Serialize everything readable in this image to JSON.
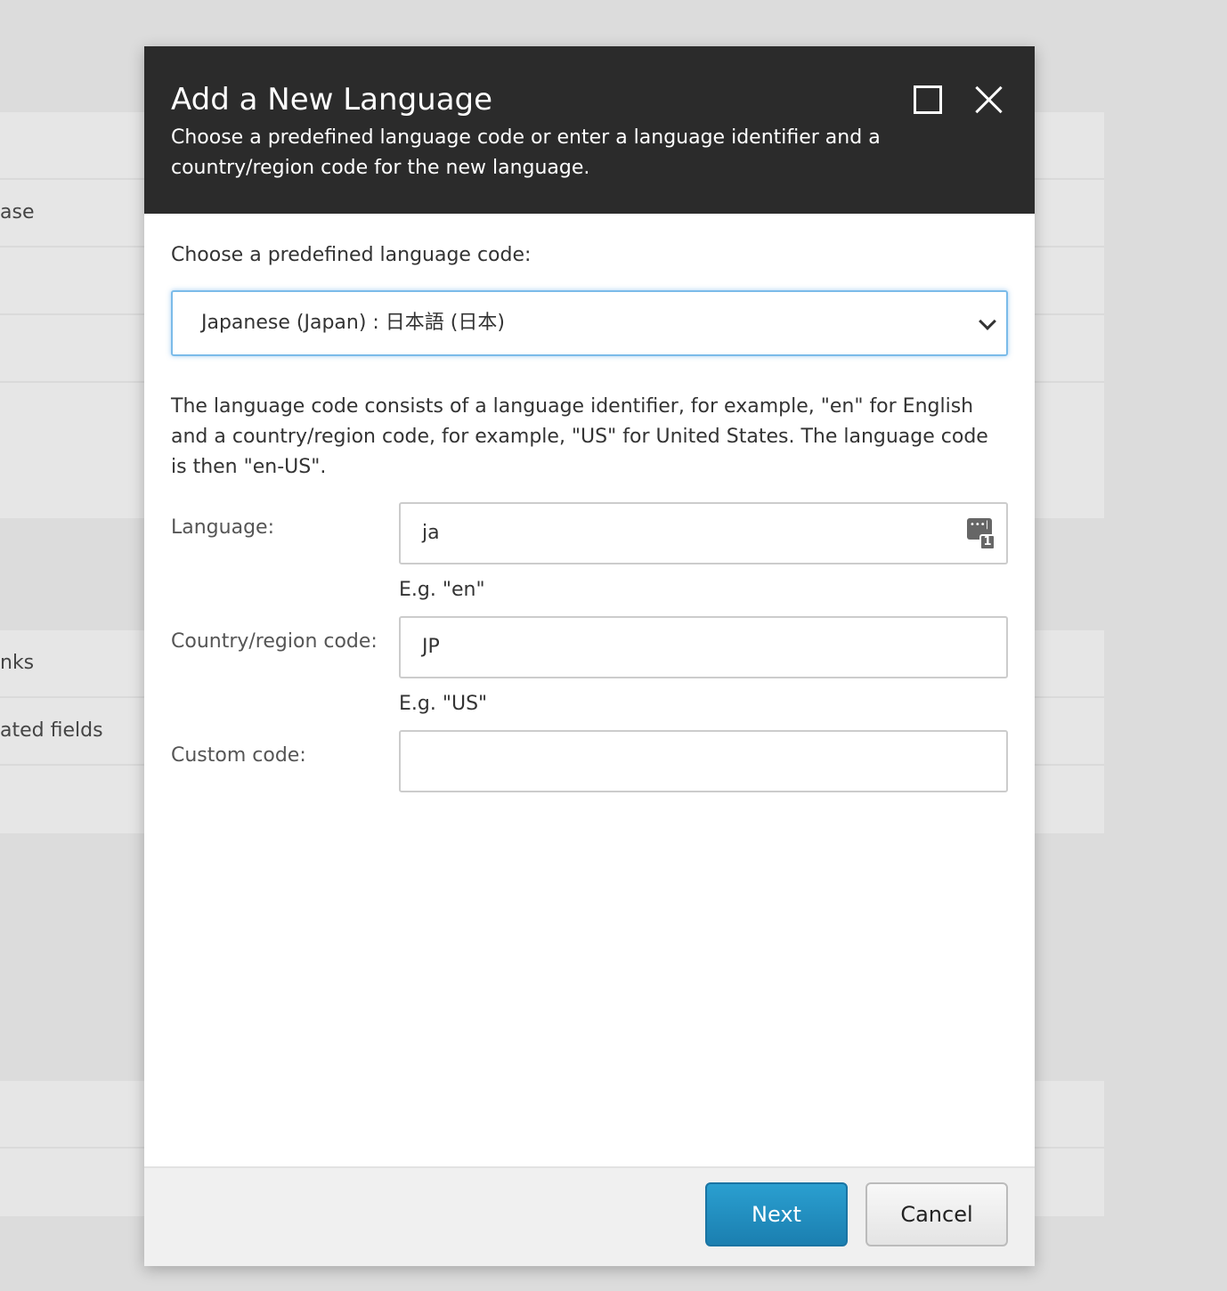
{
  "background": {
    "rows": [
      "ase",
      "nks",
      "ated fields"
    ]
  },
  "dialog": {
    "title": "Add a New Language",
    "subtitle": "Choose a predefined language code or enter a language identifier and a country/region code for the new language.",
    "predefined_label": "Choose a predefined language code:",
    "predefined_value": "Japanese (Japan) : 日本語 (日本)",
    "description": "The language code consists of a language identifier, for example, \"en\" for English and a country/region code, for example, \"US\" for United States. The language code is then \"en-US\".",
    "language": {
      "label": "Language:",
      "value": "ja",
      "hint": "E.g. \"en\"",
      "icon_badge": "1"
    },
    "country": {
      "label": "Country/region code:",
      "value": "JP",
      "hint": "E.g. \"US\""
    },
    "custom": {
      "label": "Custom code:",
      "value": ""
    },
    "next_label": "Next",
    "cancel_label": "Cancel"
  },
  "colors": {
    "accent": "#1f8ec2",
    "header": "#2b2b2b"
  }
}
